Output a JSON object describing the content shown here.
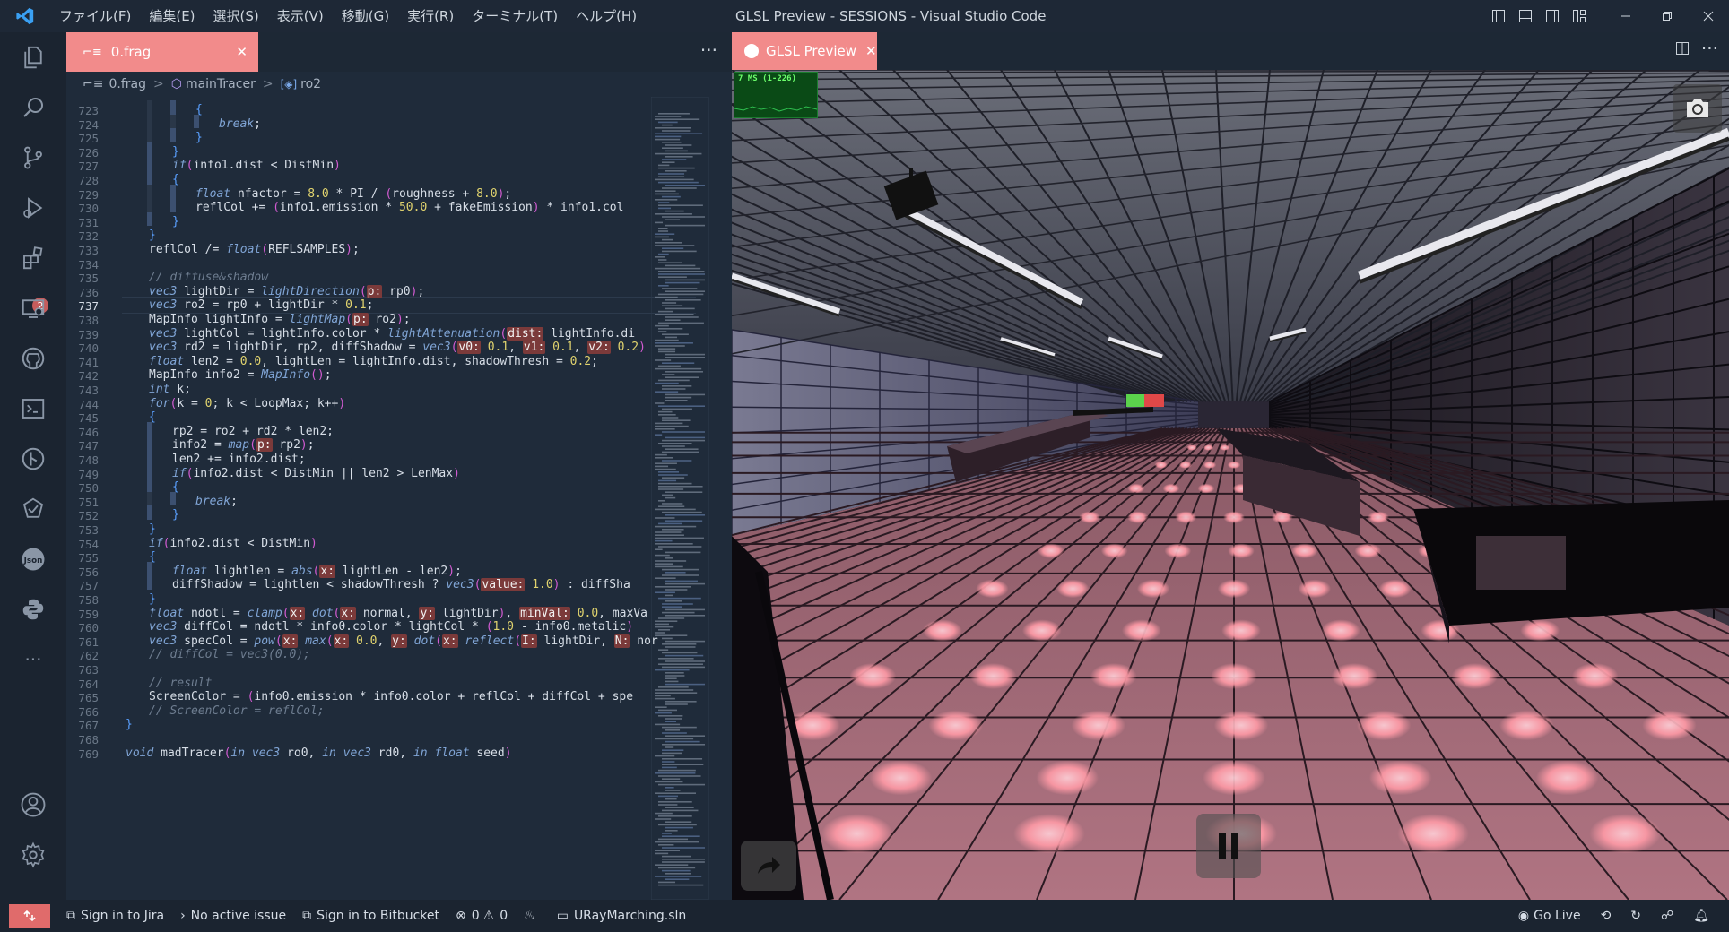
{
  "titlebar": {
    "menus": [
      "ファイル(F)",
      "編集(E)",
      "選択(S)",
      "表示(V)",
      "移動(G)",
      "実行(R)",
      "ターミナル(T)",
      "ヘルプ(H)"
    ],
    "window_title": "GLSL Preview - SESSIONS - Visual Studio Code"
  },
  "activitybar": {
    "icons": [
      "explorer-icon",
      "search-icon",
      "source-control-icon",
      "run-debug-icon",
      "extensions-icon",
      "remote-explorer-icon",
      "github-icon",
      "terminal-icon",
      "git-graph-icon",
      "testing-icon",
      "json-icon",
      "python-icon",
      "more-icon",
      "account-icon",
      "settings-gear-icon"
    ],
    "extensions_badge": "2"
  },
  "editor": {
    "tab_label": "0.frag",
    "breadcrumb": [
      "0.frag",
      "mainTracer",
      "ro2"
    ],
    "current_line": 737,
    "lines": [
      {
        "n": 723,
        "indent": 3,
        "text": "{"
      },
      {
        "n": 724,
        "indent": 4,
        "text": "break;"
      },
      {
        "n": 725,
        "indent": 3,
        "text": "}"
      },
      {
        "n": 726,
        "indent": 2,
        "text": "}"
      },
      {
        "n": 727,
        "indent": 2,
        "text": "if(info1.dist < DistMin)"
      },
      {
        "n": 728,
        "indent": 2,
        "text": "{"
      },
      {
        "n": 729,
        "indent": 3,
        "text": "float nfactor = 8.0 * PI / (roughness + 8.0);"
      },
      {
        "n": 730,
        "indent": 3,
        "text": "reflCol += (info1.emission * 50.0 + fakeEmission) * info1.col"
      },
      {
        "n": 731,
        "indent": 2,
        "text": "}"
      },
      {
        "n": 732,
        "indent": 1,
        "text": "}"
      },
      {
        "n": 733,
        "indent": 1,
        "text": "reflCol /= float(REFLSAMPLES);"
      },
      {
        "n": 734,
        "indent": 0,
        "text": ""
      },
      {
        "n": 735,
        "indent": 1,
        "text": "// diffuse&shadow"
      },
      {
        "n": 736,
        "indent": 1,
        "text": "vec3 lightDir = lightDirection(p: rp0);"
      },
      {
        "n": 737,
        "indent": 1,
        "text": "vec3 ro2 = rp0 + lightDir * 0.1;"
      },
      {
        "n": 738,
        "indent": 1,
        "text": "MapInfo lightInfo = lightMap(p: ro2);"
      },
      {
        "n": 739,
        "indent": 1,
        "text": "vec3 lightCol = lightInfo.color * lightAttenuation(dist: lightInfo.di"
      },
      {
        "n": 740,
        "indent": 1,
        "text": "vec3 rd2 = lightDir, rp2, diffShadow = vec3(v0: 0.1, v1: 0.1, v2: 0.2)"
      },
      {
        "n": 741,
        "indent": 1,
        "text": "float len2 = 0.0, lightLen = lightInfo.dist, shadowThresh = 0.2;"
      },
      {
        "n": 742,
        "indent": 1,
        "text": "MapInfo info2 = MapInfo();"
      },
      {
        "n": 743,
        "indent": 1,
        "text": "int k;"
      },
      {
        "n": 744,
        "indent": 1,
        "text": "for(k = 0; k < LoopMax; k++)"
      },
      {
        "n": 745,
        "indent": 1,
        "text": "{"
      },
      {
        "n": 746,
        "indent": 2,
        "text": "rp2 = ro2 + rd2 * len2;"
      },
      {
        "n": 747,
        "indent": 2,
        "text": "info2 = map(p: rp2);"
      },
      {
        "n": 748,
        "indent": 2,
        "text": "len2 += info2.dist;"
      },
      {
        "n": 749,
        "indent": 2,
        "text": "if(info2.dist < DistMin || len2 > LenMax)"
      },
      {
        "n": 750,
        "indent": 2,
        "text": "{"
      },
      {
        "n": 751,
        "indent": 3,
        "text": "break;"
      },
      {
        "n": 752,
        "indent": 2,
        "text": "}"
      },
      {
        "n": 753,
        "indent": 1,
        "text": "}"
      },
      {
        "n": 754,
        "indent": 1,
        "text": "if(info2.dist < DistMin)"
      },
      {
        "n": 755,
        "indent": 1,
        "text": "{"
      },
      {
        "n": 756,
        "indent": 2,
        "text": "float lightlen = abs(x: lightLen - len2);"
      },
      {
        "n": 757,
        "indent": 2,
        "text": "diffShadow = lightlen < shadowThresh ? vec3(value: 1.0) : diffSha"
      },
      {
        "n": 758,
        "indent": 1,
        "text": "}"
      },
      {
        "n": 759,
        "indent": 1,
        "text": "float ndotl = clamp(x: dot(x: normal, y: lightDir), minVal: 0.0, maxVa"
      },
      {
        "n": 760,
        "indent": 1,
        "text": "vec3 diffCol = ndotl * info0.color * lightCol * (1.0 - info0.metalic)"
      },
      {
        "n": 761,
        "indent": 1,
        "text": "vec3 specCol = pow(x: max(x: 0.0, y: dot(x: reflect(I: lightDir, N: nor"
      },
      {
        "n": 762,
        "indent": 1,
        "text": "// diffCol = vec3(0.0);"
      },
      {
        "n": 763,
        "indent": 0,
        "text": ""
      },
      {
        "n": 764,
        "indent": 1,
        "text": "// result"
      },
      {
        "n": 765,
        "indent": 1,
        "text": "ScreenColor = (info0.emission * info0.color + reflCol + diffCol + spe"
      },
      {
        "n": 766,
        "indent": 1,
        "text": "// ScreenColor = reflCol;"
      },
      {
        "n": 767,
        "indent": 0,
        "text": "}"
      },
      {
        "n": 768,
        "indent": 0,
        "text": ""
      },
      {
        "n": 769,
        "indent": 0,
        "text": "void madTracer(in vec3 ro0, in vec3 rd0, in float seed)"
      }
    ]
  },
  "preview": {
    "tab_label": "GLSL Preview",
    "fps_text": "7 MS (1-226)"
  },
  "statusbar": {
    "jira": "Sign in to Jira",
    "issue": "No active issue",
    "bitbucket": "Sign in to Bitbucket",
    "errors": "0",
    "warnings": "0",
    "solution": "URayMarching.sln",
    "golive": "Go Live"
  },
  "colors": {
    "accent_tab": "#f28b8b",
    "remote_button": "#e06b6b",
    "editor_bg": "#1f2b3a"
  }
}
